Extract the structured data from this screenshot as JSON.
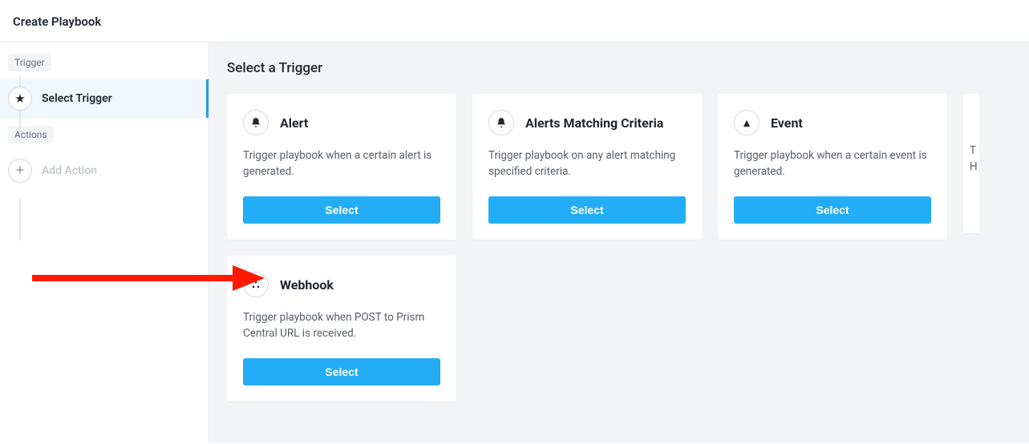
{
  "header_title": "Create Playbook",
  "sidebar": {
    "trigger_label": "Trigger",
    "select_trigger": "Select Trigger",
    "actions_label": "Actions",
    "add_action": "Add Action"
  },
  "main": {
    "title": "Select a Trigger"
  },
  "cards": [
    {
      "icon": "bell-icon",
      "glyph": "🔔",
      "title": "Alert",
      "desc": "Trigger playbook when a certain alert is generated.",
      "button": "Select"
    },
    {
      "icon": "bell-icon",
      "glyph": "🔔",
      "title": "Alerts Matching Criteria",
      "desc": "Trigger playbook on any alert matching specified criteria.",
      "button": "Select"
    },
    {
      "icon": "triangle-icon",
      "glyph": "▲",
      "title": "Event",
      "desc": "Trigger playbook when a certain event is generated.",
      "button": "Select"
    },
    {
      "icon": "webhook-icon",
      "glyph": "⚙",
      "title": "Webhook",
      "desc": "Trigger playbook when POST to Prism Central URL is received.",
      "button": "Select"
    }
  ],
  "peek": {
    "line1": "T",
    "line2": "H"
  }
}
